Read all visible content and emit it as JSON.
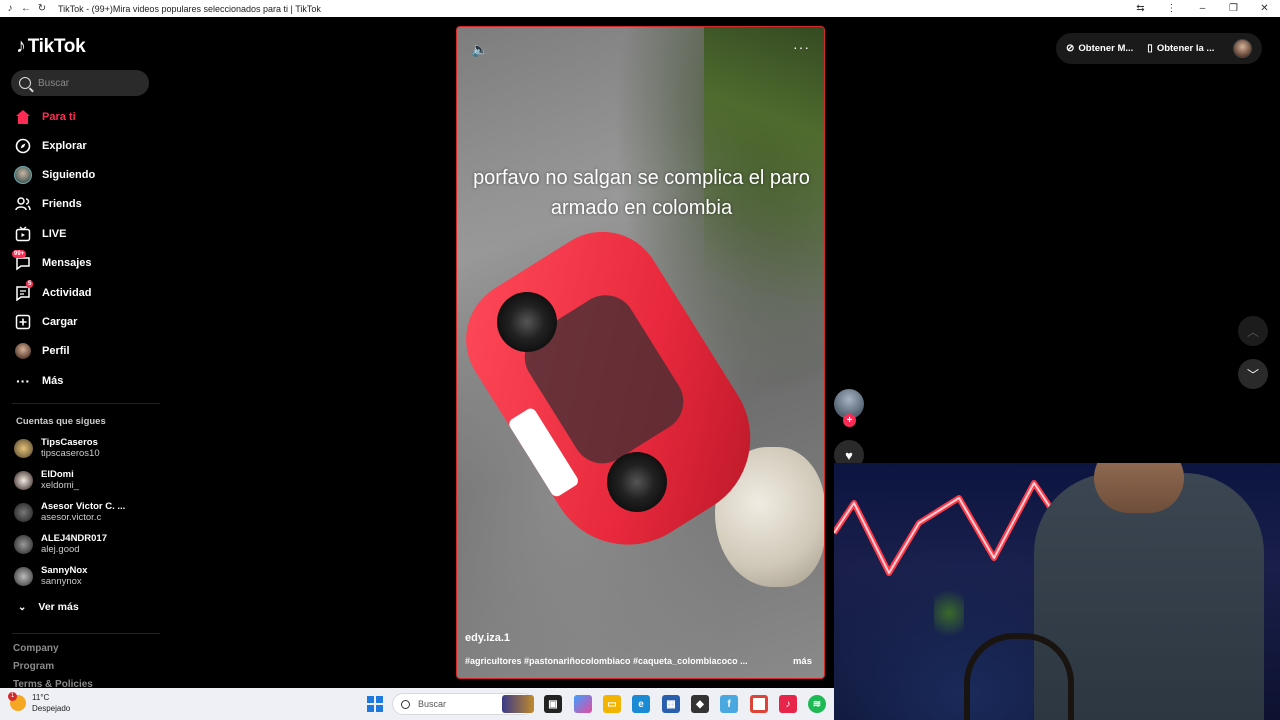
{
  "browser": {
    "title": "TikTok - (99+)Mira videos populares seleccionados para ti | TikTok"
  },
  "sidebar": {
    "logo": "TikTok",
    "search_placeholder": "Buscar",
    "nav": [
      {
        "label": "Para ti",
        "icon": "home-icon",
        "active": true
      },
      {
        "label": "Explorar",
        "icon": "compass-icon"
      },
      {
        "label": "Siguiendo",
        "icon": "following-avatar-icon"
      },
      {
        "label": "Friends",
        "icon": "friends-icon"
      },
      {
        "label": "LIVE",
        "icon": "live-icon"
      },
      {
        "label": "Mensajes",
        "icon": "messages-icon",
        "badge": "99+"
      },
      {
        "label": "Actividad",
        "icon": "activity-icon",
        "badge": "5"
      },
      {
        "label": "Cargar",
        "icon": "upload-icon"
      },
      {
        "label": "Perfil",
        "icon": "profile-avatar-icon"
      },
      {
        "label": "Más",
        "icon": "more-dots-icon"
      }
    ],
    "following_title": "Cuentas que sigues",
    "accounts": [
      {
        "name": "TipsCaseros",
        "handle": "tipscaseros10",
        "color": "#8a7a5a"
      },
      {
        "name": "ElDomi",
        "handle": "xeldomi_",
        "color": "#e8e0d8"
      },
      {
        "name": "Asesor Victor C. ...",
        "handle": "asesor.victor.c",
        "color": "#5a5a5a"
      },
      {
        "name": "ALEJ4NDR017",
        "handle": "alej.good",
        "color": "#7a7a7a"
      },
      {
        "name": "SannyNox",
        "handle": "sannynox",
        "color": "#9a9a9a"
      }
    ],
    "see_more": "Ver más",
    "footer": [
      "Company",
      "Program",
      "Terms & Policies"
    ]
  },
  "video": {
    "overlay_text": "porfavo no salgan se complica el paro armado en colombia",
    "author": "edy.iza.1",
    "hashtags": "#agricultores #pastonariñocolombiaco #caqueta_colombiacoco ...",
    "more": "más"
  },
  "top_bar": {
    "get_app_1": "Obtener M...",
    "get_app_2": "Obtener la ..."
  },
  "taskbar": {
    "temperature": "11°C",
    "weather": "Despejado",
    "weather_badge": "1",
    "search_placeholder": "Buscar"
  }
}
